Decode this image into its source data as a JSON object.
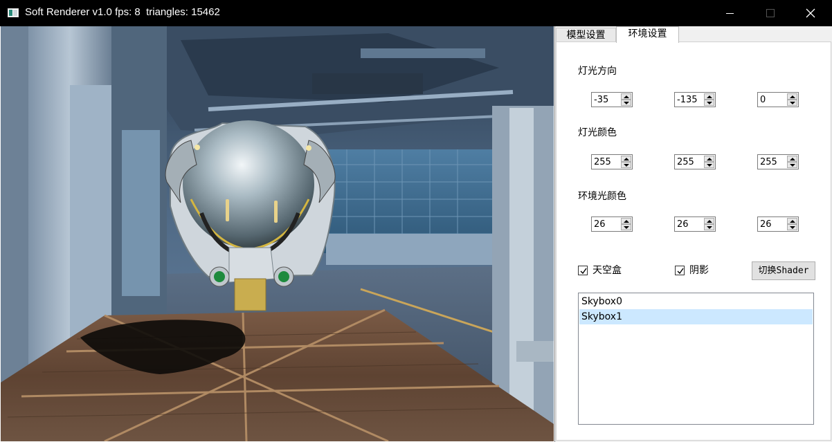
{
  "window": {
    "title": "Soft Renderer v1.0 fps: 8  triangles: 15462"
  },
  "tabs": [
    {
      "label": "模型设置",
      "active": false
    },
    {
      "label": "环境设置",
      "active": true
    }
  ],
  "env": {
    "light_dir_label": "灯光方向",
    "light_dir": [
      "-35",
      "-135",
      "0"
    ],
    "light_color_label": "灯光颜色",
    "light_color": [
      "255",
      "255",
      "255"
    ],
    "ambient_label": "环境光颜色",
    "ambient": [
      "26",
      "26",
      "26"
    ],
    "skybox_label": "天空盒",
    "skybox_checked": true,
    "shadow_label": "阴影",
    "shadow_checked": true,
    "switch_shader_label": "切换Shader",
    "skyboxes": [
      "Skybox0",
      "Skybox1"
    ],
    "selected_skybox": 1
  },
  "colors": {
    "selection": "#cce8ff",
    "titlebar": "#000000"
  }
}
